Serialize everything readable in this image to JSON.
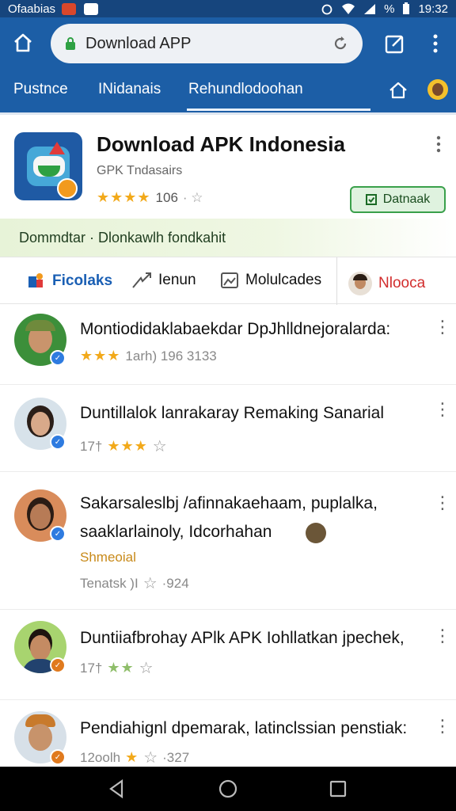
{
  "status_bar": {
    "carrier": "Ofaabias",
    "time": "19:32",
    "battery": "%"
  },
  "browser": {
    "url_text": "Download APP"
  },
  "tabs": [
    {
      "label": "Pustnce"
    },
    {
      "label": "INidanais"
    },
    {
      "label": "Rehundlodoohan"
    }
  ],
  "app": {
    "title": "Download  APK Indonesia",
    "subtitle": "GPK Tndasairs",
    "rating_count": "106",
    "download_label": "Datnaak"
  },
  "banner": {
    "text": "Dommdtar · Dlonkawlh fondkahit"
  },
  "quick_actions": [
    {
      "label": "Ficolaks",
      "color": "#1a5fb4"
    },
    {
      "label": "Ienun",
      "color": "#333333"
    },
    {
      "label": "Molulcades",
      "color": "#333333"
    },
    {
      "label": "Nlooca",
      "color": "#d22d2d"
    }
  ],
  "reviews": [
    {
      "text": "Montiodidaklabaekdar DpJhlldnejoralarda:",
      "meta": "1arh) 196 3133",
      "stars": "★★★",
      "badge_color": "#2e7be0"
    },
    {
      "text": "Duntillalok lanrakaray Remaking Sanarial",
      "meta": "17†",
      "stars": "★★★",
      "badge_color": "#2e7be0"
    },
    {
      "text": "Sakarsaleslbj /afinnakaehaam, puplalka, saaklarlainoly, Idcorhahan",
      "tag": "Shmeoial",
      "meta": "Tenatsk )I",
      "meta2": "·924",
      "badge_color": "#2e7be0"
    },
    {
      "text": "Duntiiafbrohay APlk APK Iohllatkan jpechek,",
      "meta": "17†",
      "stars": "★★",
      "badge_color": "#e07a1e"
    },
    {
      "text": "Pendiahignl dpemarak, latinclssian penstiak:",
      "meta": "12oolh",
      "stars": "★",
      "meta2": "·327",
      "badge_color": "#e07a1e"
    }
  ],
  "colors": {
    "primary": "#1c5ea6",
    "accent_green": "#3aa04b",
    "star": "#f2a91a",
    "alert_red": "#d22d2d"
  }
}
